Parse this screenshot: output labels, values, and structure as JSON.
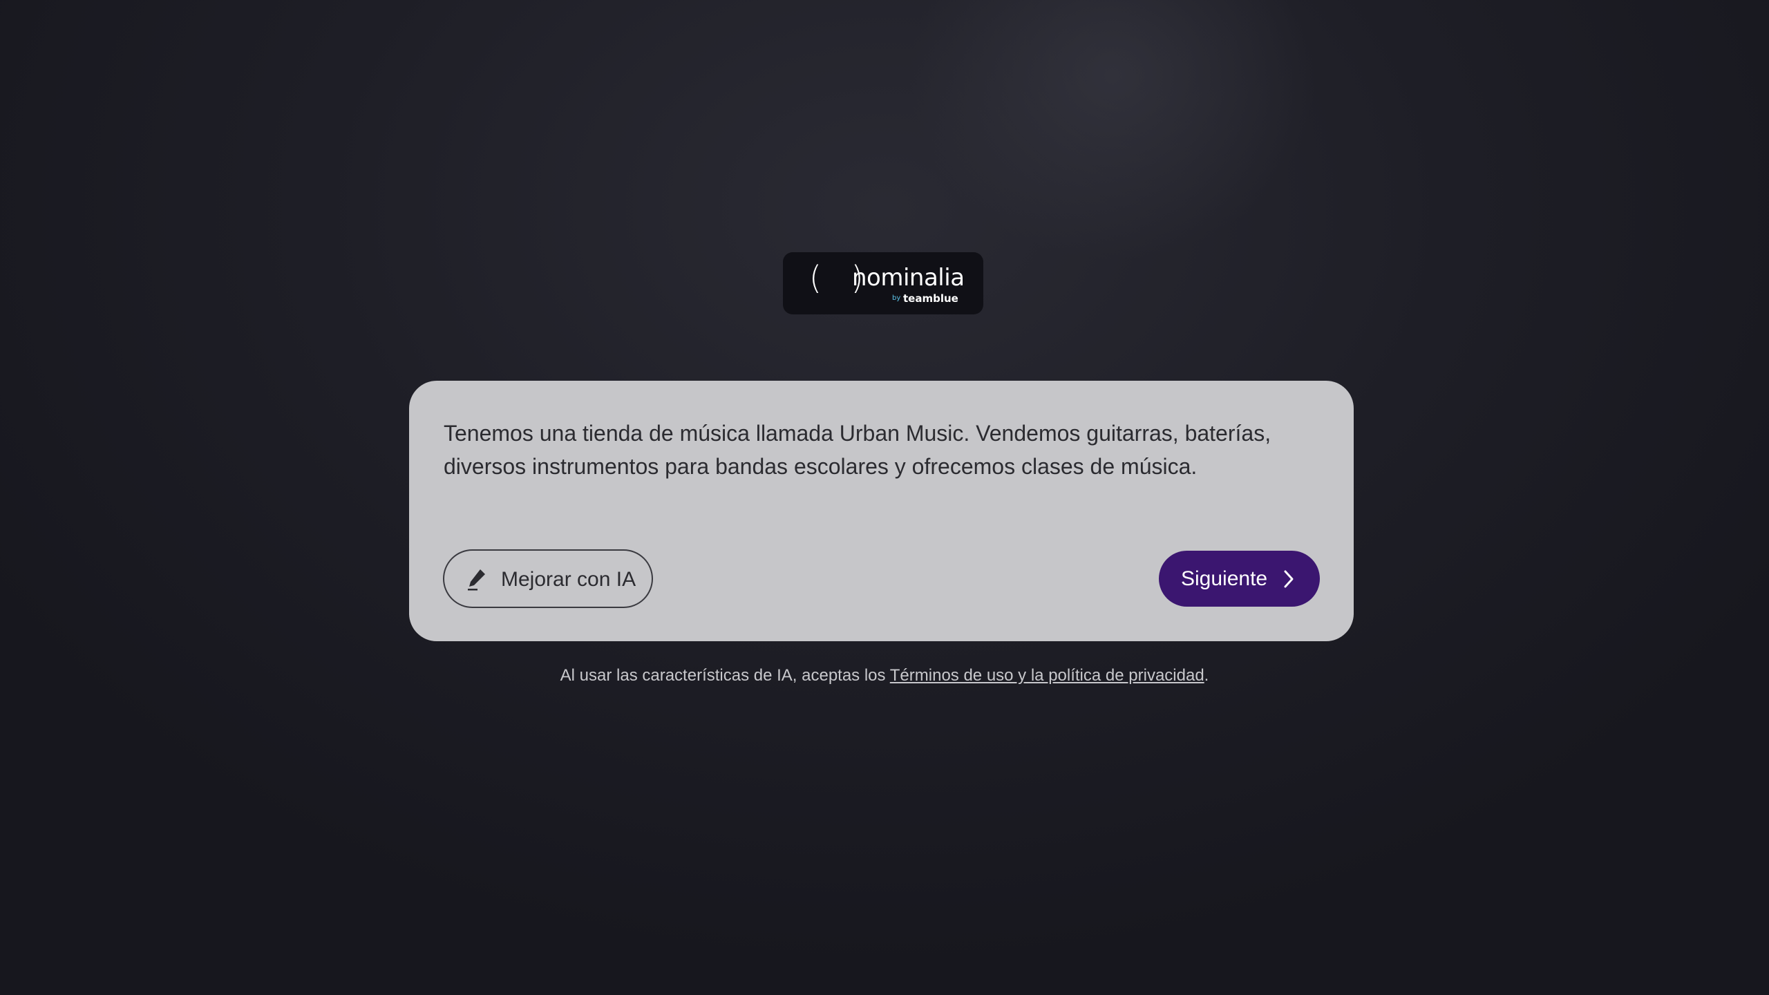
{
  "brand": {
    "logo_parens": "( )",
    "logo_word": "nominalia",
    "logo_by": "by",
    "logo_teamblue": "teamblue"
  },
  "prompt": {
    "text": "Tenemos una tienda de música llamada Urban Music. Vendemos guitarras, baterías, diversos instrumentos para bandas escolares y ofrecemos clases de música."
  },
  "actions": {
    "improve_label": "Mejorar con IA",
    "improve_icon": "pencil-icon",
    "next_label": "Siguiente",
    "next_icon": "chevron-right-icon"
  },
  "footer": {
    "prefix": "Al usar las características de IA, aceptas los",
    "link_text": "Términos de uso y la política de privacidad",
    "suffix": "."
  },
  "colors": {
    "accent": "#3b1670",
    "card_bg": "#c6c6c9",
    "page_bg": "#1e1e26"
  }
}
